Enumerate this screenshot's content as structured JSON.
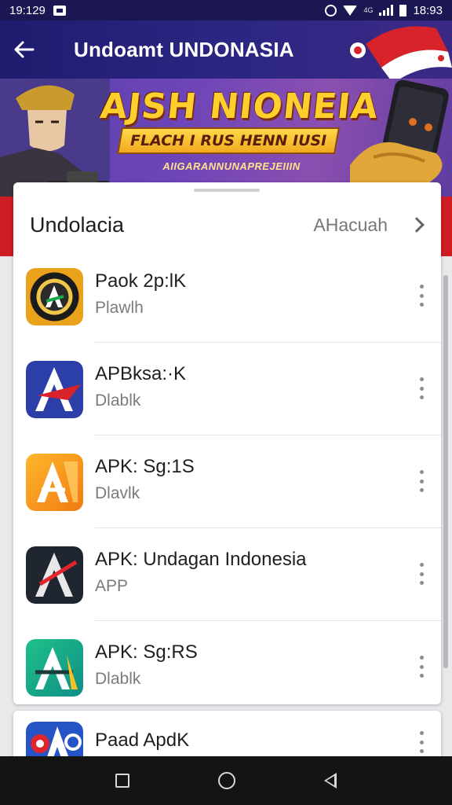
{
  "status_bar": {
    "time_left": "19:129",
    "time_right": "18:93",
    "signal_text": "4G"
  },
  "app_bar": {
    "title": "Undoamt UNDONASIA"
  },
  "banner": {
    "headline": "AJSH NIONEIA",
    "ribbon_text": "FLACH I RUS HENN IUSI",
    "subline": "AIIGARANNUNAPREJEIIIN"
  },
  "card": {
    "title": "Undolacia",
    "action_label": "AHacuah"
  },
  "apps": [
    {
      "name": "Paok 2p:lK",
      "subtitle": "Plawlh",
      "icon": "apk-emblem-icon"
    },
    {
      "name": "APBksa:·K",
      "subtitle": "Dlablk",
      "icon": "apk-blue-icon"
    },
    {
      "name": "APK: Sg:1S",
      "subtitle": "Dlavlk",
      "icon": "apk-orange-icon"
    },
    {
      "name": "APK: Undagan Indonesia",
      "subtitle": "APP",
      "icon": "apk-dark-icon"
    },
    {
      "name": "APK: Sg:RS",
      "subtitle": "Dlablk",
      "icon": "apk-teal-icon"
    }
  ],
  "partial_app": {
    "name": "Paad ApdK",
    "icon": "apk-partial-icon"
  },
  "colors": {
    "app_bar": "#1f1c6e",
    "accent_red": "#cf1b22",
    "banner_yellow": "#ffcf2e"
  }
}
